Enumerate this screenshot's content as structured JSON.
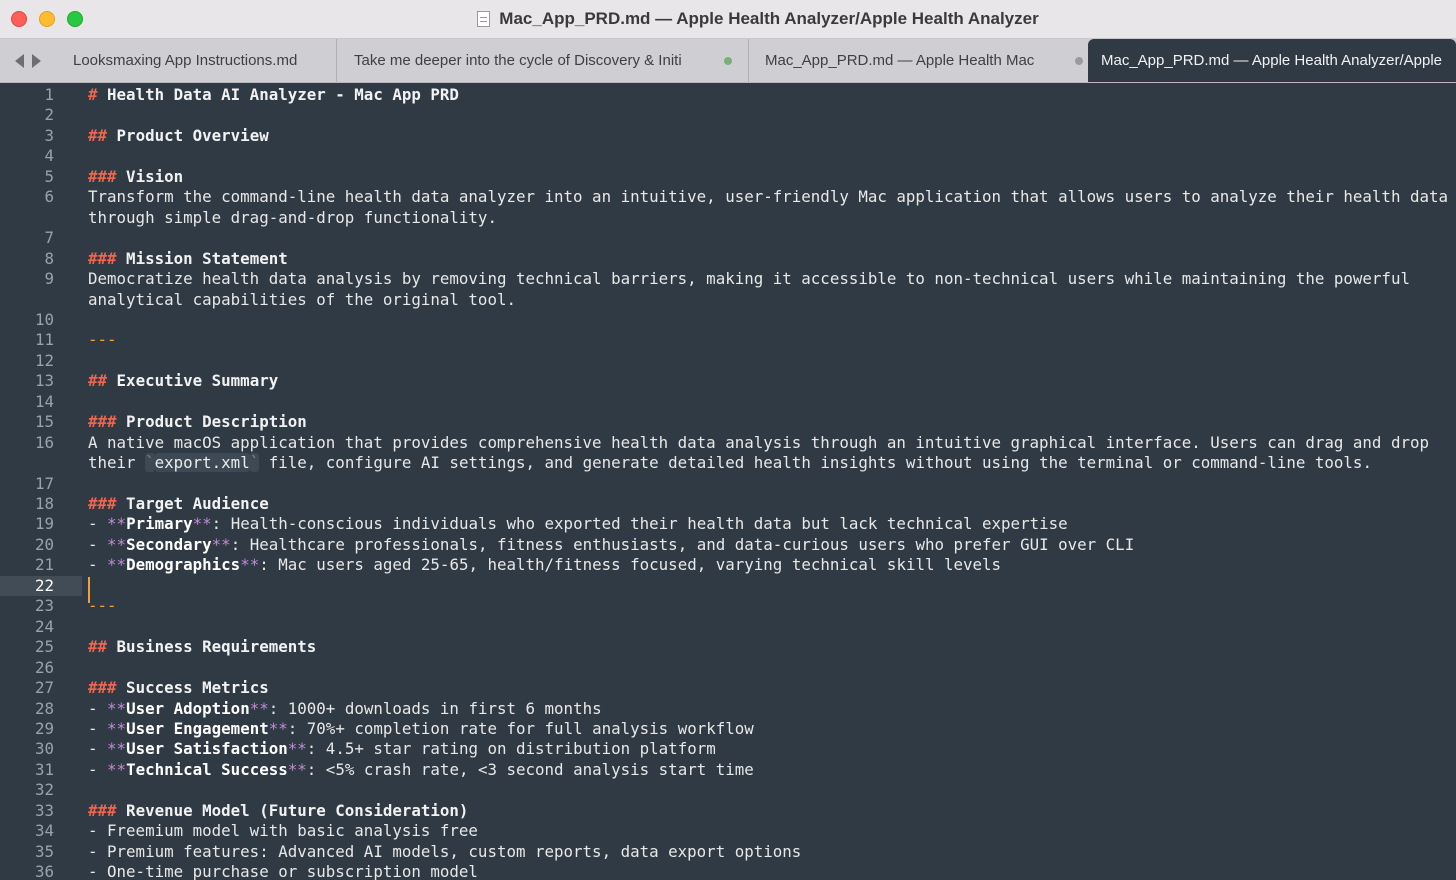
{
  "window": {
    "title": "Mac_App_PRD.md — Apple Health Analyzer/Apple Health Analyzer"
  },
  "tabs": [
    {
      "label": "Looksmaxing App Instructions.md",
      "active": false,
      "modified": false
    },
    {
      "label": "Take me deeper into the cycle of Discovery & Initi",
      "active": false,
      "modified": true
    },
    {
      "label": "Mac_App_PRD.md — Apple Health Mac",
      "active": false,
      "modified": true
    },
    {
      "label": "Mac_App_PRD.md — Apple Health Analyzer/Apple",
      "active": true,
      "modified": false
    }
  ],
  "colors": {
    "editor_background": "#2f3a44",
    "heading_marker": "#f0654e",
    "bold_marker": "#c68ad6",
    "rule_and_caret": "#f0a13a",
    "modified_dot": "#7cae7a"
  },
  "editor": {
    "current_line": 22,
    "lines": [
      {
        "n": "1",
        "segs": [
          {
            "t": "#",
            "c": "md-hash"
          },
          {
            "t": " Health Data AI Analyzer - Mac App PRD",
            "c": "md-head"
          }
        ]
      },
      {
        "n": "2",
        "segs": []
      },
      {
        "n": "3",
        "segs": [
          {
            "t": "##",
            "c": "md-hash"
          },
          {
            "t": " Product Overview",
            "c": "md-head"
          }
        ]
      },
      {
        "n": "4",
        "segs": []
      },
      {
        "n": "5",
        "segs": [
          {
            "t": "###",
            "c": "md-hash"
          },
          {
            "t": " Vision",
            "c": "md-head"
          }
        ]
      },
      {
        "n": "6",
        "segs": [
          {
            "t": "Transform the command-line health data analyzer into an intuitive, user-friendly Mac application that allows users to analyze their health data",
            "c": ""
          }
        ]
      },
      {
        "n": "",
        "segs": [
          {
            "t": "through simple drag-and-drop functionality.",
            "c": ""
          }
        ]
      },
      {
        "n": "7",
        "segs": []
      },
      {
        "n": "8",
        "segs": [
          {
            "t": "###",
            "c": "md-hash"
          },
          {
            "t": " Mission Statement",
            "c": "md-head"
          }
        ]
      },
      {
        "n": "9",
        "segs": [
          {
            "t": "Democratize health data analysis by removing technical barriers, making it accessible to non-technical users while maintaining the powerful",
            "c": ""
          }
        ]
      },
      {
        "n": "",
        "segs": [
          {
            "t": "analytical capabilities of the original tool.",
            "c": ""
          }
        ]
      },
      {
        "n": "10",
        "segs": []
      },
      {
        "n": "11",
        "segs": [
          {
            "t": "---",
            "c": "md-rule"
          }
        ]
      },
      {
        "n": "12",
        "segs": []
      },
      {
        "n": "13",
        "segs": [
          {
            "t": "##",
            "c": "md-hash"
          },
          {
            "t": " Executive Summary",
            "c": "md-head"
          }
        ]
      },
      {
        "n": "14",
        "segs": []
      },
      {
        "n": "15",
        "segs": [
          {
            "t": "###",
            "c": "md-hash"
          },
          {
            "t": " Product Description",
            "c": "md-head"
          }
        ]
      },
      {
        "n": "16",
        "segs": [
          {
            "t": "A native macOS application that provides comprehensive health data analysis through an intuitive graphical interface. Users can drag and drop",
            "c": ""
          }
        ]
      },
      {
        "n": "",
        "segs": [
          {
            "t": "their ",
            "c": ""
          },
          {
            "t": "`",
            "c": "md-code md-tick"
          },
          {
            "t": "export.xml",
            "c": "md-code"
          },
          {
            "t": "`",
            "c": "md-code md-tick"
          },
          {
            "t": " file, configure AI settings, and generate detailed health insights without using the terminal or command-line tools.",
            "c": ""
          }
        ]
      },
      {
        "n": "17",
        "segs": []
      },
      {
        "n": "18",
        "segs": [
          {
            "t": "###",
            "c": "md-hash"
          },
          {
            "t": " Target Audience",
            "c": "md-head"
          }
        ]
      },
      {
        "n": "19",
        "segs": [
          {
            "t": "- ",
            "c": "md-dash"
          },
          {
            "t": "**",
            "c": "md-star"
          },
          {
            "t": "Primary",
            "c": "md-bold"
          },
          {
            "t": "**",
            "c": "md-star"
          },
          {
            "t": ": Health-conscious individuals who exported their health data but lack technical expertise",
            "c": ""
          }
        ]
      },
      {
        "n": "20",
        "segs": [
          {
            "t": "- ",
            "c": "md-dash"
          },
          {
            "t": "**",
            "c": "md-star"
          },
          {
            "t": "Secondary",
            "c": "md-bold"
          },
          {
            "t": "**",
            "c": "md-star"
          },
          {
            "t": ": Healthcare professionals, fitness enthusiasts, and data-curious users who prefer GUI over CLI",
            "c": ""
          }
        ]
      },
      {
        "n": "21",
        "segs": [
          {
            "t": "- ",
            "c": "md-dash"
          },
          {
            "t": "**",
            "c": "md-star"
          },
          {
            "t": "Demographics",
            "c": "md-bold"
          },
          {
            "t": "**",
            "c": "md-star"
          },
          {
            "t": ": Mac users aged 25-65, health/fitness focused, varying technical skill levels",
            "c": ""
          }
        ]
      },
      {
        "n": "22",
        "segs": [],
        "current": true
      },
      {
        "n": "23",
        "segs": [
          {
            "t": "---",
            "c": "md-rule"
          }
        ]
      },
      {
        "n": "24",
        "segs": []
      },
      {
        "n": "25",
        "segs": [
          {
            "t": "##",
            "c": "md-hash"
          },
          {
            "t": " Business Requirements",
            "c": "md-head"
          }
        ]
      },
      {
        "n": "26",
        "segs": []
      },
      {
        "n": "27",
        "segs": [
          {
            "t": "###",
            "c": "md-hash"
          },
          {
            "t": " Success Metrics",
            "c": "md-head"
          }
        ]
      },
      {
        "n": "28",
        "segs": [
          {
            "t": "- ",
            "c": "md-dash"
          },
          {
            "t": "**",
            "c": "md-star"
          },
          {
            "t": "User Adoption",
            "c": "md-bold"
          },
          {
            "t": "**",
            "c": "md-star"
          },
          {
            "t": ": 1000+ downloads in first 6 months",
            "c": ""
          }
        ]
      },
      {
        "n": "29",
        "segs": [
          {
            "t": "- ",
            "c": "md-dash"
          },
          {
            "t": "**",
            "c": "md-star"
          },
          {
            "t": "User Engagement",
            "c": "md-bold"
          },
          {
            "t": "**",
            "c": "md-star"
          },
          {
            "t": ": 70%+ completion rate for full analysis workflow",
            "c": ""
          }
        ]
      },
      {
        "n": "30",
        "segs": [
          {
            "t": "- ",
            "c": "md-dash"
          },
          {
            "t": "**",
            "c": "md-star"
          },
          {
            "t": "User Satisfaction",
            "c": "md-bold"
          },
          {
            "t": "**",
            "c": "md-star"
          },
          {
            "t": ": 4.5+ star rating on distribution platform",
            "c": ""
          }
        ]
      },
      {
        "n": "31",
        "segs": [
          {
            "t": "- ",
            "c": "md-dash"
          },
          {
            "t": "**",
            "c": "md-star"
          },
          {
            "t": "Technical Success",
            "c": "md-bold"
          },
          {
            "t": "**",
            "c": "md-star"
          },
          {
            "t": ": <5% crash rate, <3 second analysis start time",
            "c": ""
          }
        ]
      },
      {
        "n": "32",
        "segs": []
      },
      {
        "n": "33",
        "segs": [
          {
            "t": "###",
            "c": "md-hash"
          },
          {
            "t": " Revenue Model (Future Consideration)",
            "c": "md-head"
          }
        ]
      },
      {
        "n": "34",
        "segs": [
          {
            "t": "- Freemium model with basic analysis free",
            "c": ""
          }
        ]
      },
      {
        "n": "35",
        "segs": [
          {
            "t": "- Premium features: Advanced AI models, custom reports, data export options",
            "c": ""
          }
        ]
      },
      {
        "n": "36",
        "segs": [
          {
            "t": "- One-time purchase or subscription model",
            "c": ""
          }
        ]
      }
    ]
  }
}
